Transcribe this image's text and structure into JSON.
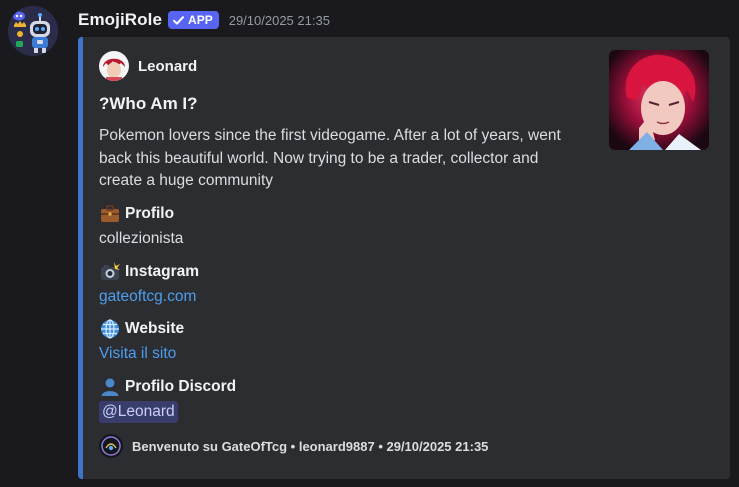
{
  "bot": {
    "name": "EmojiRole",
    "tag": "APP",
    "timestamp": "29/10/2025 21:35"
  },
  "embed": {
    "accent_color": "#3d74c8",
    "author": {
      "name": "Leonard"
    },
    "title": "?Who Am I?",
    "description": "Pokemon lovers since the first videogame. After a lot of years, went back this beautiful world. Now trying to be a trader, collector and create a huge community",
    "fields": [
      {
        "icon": "briefcase-icon",
        "name": "Profilo",
        "value": "collezionista"
      },
      {
        "icon": "camera-flash-icon",
        "name": "Instagram",
        "value": "gateoftcg.com"
      },
      {
        "icon": "globe-icon",
        "name": "Website",
        "value": "Visita il sito"
      },
      {
        "icon": "user-silhouette-icon",
        "name": "Profilo Discord",
        "value": "@Leonard"
      }
    ],
    "footer": "Benvenuto su GateOfTcg • leonard9887 • 29/10/2025 21:35"
  },
  "colors": {
    "background": "#1a1a1e",
    "embed_background": "#2b2d31",
    "app_tag": "#5865f2",
    "link": "#4e9ef0",
    "mention_text": "#c9cdfb"
  }
}
